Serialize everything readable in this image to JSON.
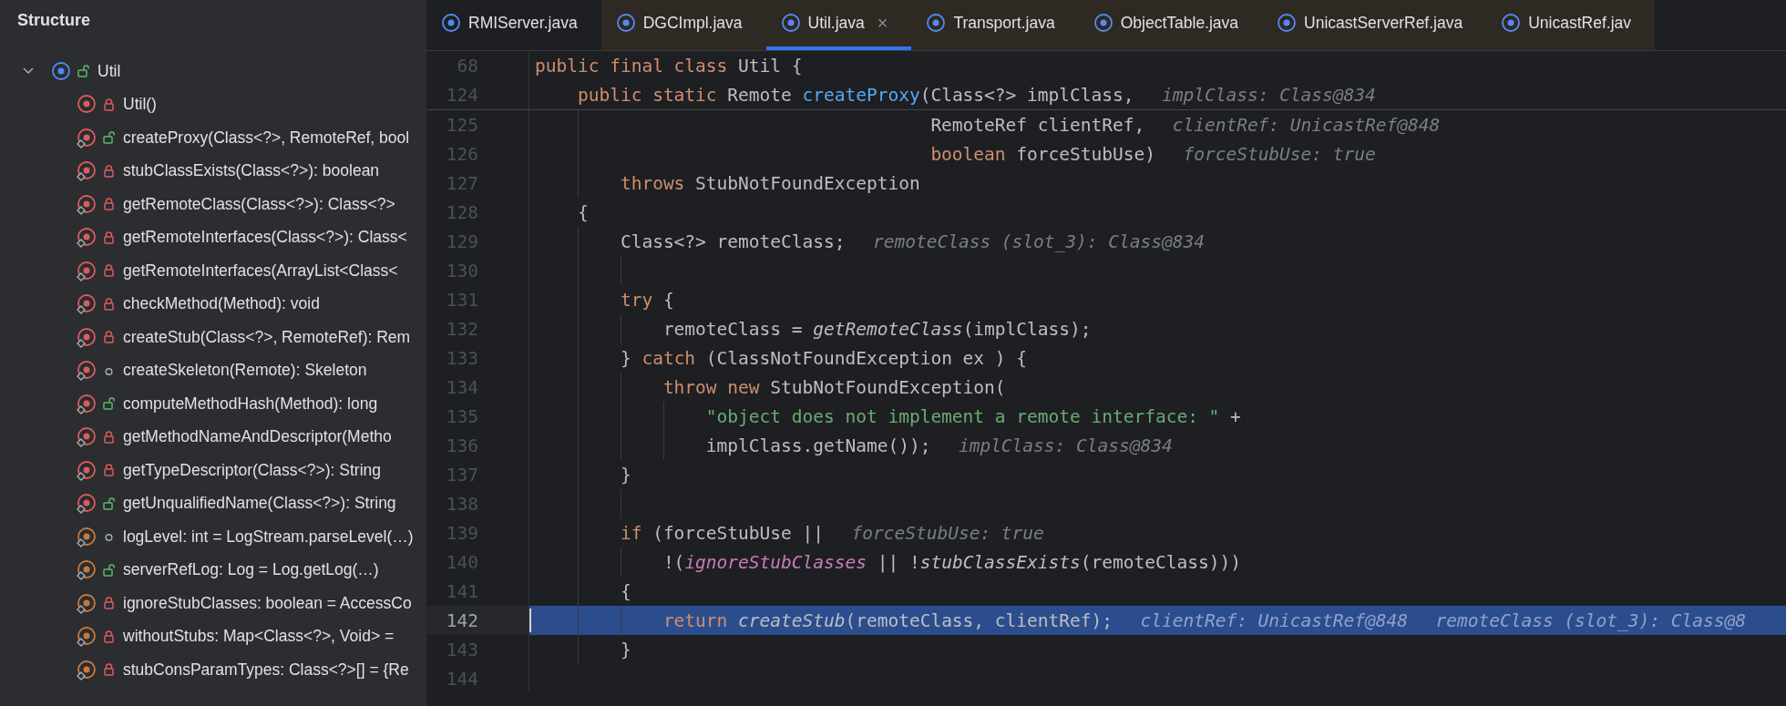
{
  "sidebar": {
    "title": "Structure",
    "tree": {
      "label": "Util",
      "kind": "class",
      "public": true,
      "private": false,
      "static": false,
      "expanded": true,
      "children": [
        {
          "label": "Util()",
          "kind": "method",
          "public": false,
          "private": true,
          "static": false
        },
        {
          "label": "createProxy(Class<?>, RemoteRef, bool",
          "kind": "method",
          "public": true,
          "private": false,
          "static": true
        },
        {
          "label": "stubClassExists(Class<?>): boolean",
          "kind": "method",
          "public": false,
          "private": true,
          "static": true
        },
        {
          "label": "getRemoteClass(Class<?>): Class<?>",
          "kind": "method",
          "public": false,
          "private": true,
          "static": true
        },
        {
          "label": "getRemoteInterfaces(Class<?>): Class<",
          "kind": "method",
          "public": false,
          "private": true,
          "static": true
        },
        {
          "label": "getRemoteInterfaces(ArrayList<Class<",
          "kind": "method",
          "public": false,
          "private": true,
          "static": true
        },
        {
          "label": "checkMethod(Method): void",
          "kind": "method",
          "public": false,
          "private": true,
          "static": true
        },
        {
          "label": "createStub(Class<?>, RemoteRef): Rem",
          "kind": "method",
          "public": false,
          "private": true,
          "static": true
        },
        {
          "label": "createSkeleton(Remote): Skeleton",
          "kind": "method",
          "public": false,
          "private": false,
          "static": true
        },
        {
          "label": "computeMethodHash(Method): long",
          "kind": "method",
          "public": true,
          "private": false,
          "static": true
        },
        {
          "label": "getMethodNameAndDescriptor(Metho",
          "kind": "method",
          "public": false,
          "private": true,
          "static": true
        },
        {
          "label": "getTypeDescriptor(Class<?>): String",
          "kind": "method",
          "public": false,
          "private": true,
          "static": true
        },
        {
          "label": "getUnqualifiedName(Class<?>): String",
          "kind": "method",
          "public": true,
          "private": false,
          "static": true
        },
        {
          "label": "logLevel: int = LogStream.parseLevel(…)",
          "kind": "field",
          "public": false,
          "private": false,
          "static": true
        },
        {
          "label": "serverRefLog: Log = Log.getLog(…)",
          "kind": "field",
          "public": true,
          "private": false,
          "static": true
        },
        {
          "label": "ignoreStubClasses: boolean = AccessCo",
          "kind": "field",
          "public": false,
          "private": true,
          "static": true
        },
        {
          "label": "withoutStubs: Map<Class<?>, Void> =",
          "kind": "field",
          "public": false,
          "private": true,
          "static": true
        },
        {
          "label": "stubConsParamTypes: Class<?>[] = {Re",
          "kind": "field",
          "public": false,
          "private": true,
          "static": true
        }
      ]
    }
  },
  "tabs": [
    {
      "label": "RMIServer.java",
      "selected": false,
      "color": "#1e1f22"
    },
    {
      "label": "DGCImpl.java",
      "selected": false,
      "color": "#2e2922"
    },
    {
      "label": "Util.java",
      "selected": true,
      "color": "#2e2922",
      "close": "×"
    },
    {
      "label": "Transport.java",
      "selected": false,
      "color": "#2e2922"
    },
    {
      "label": "ObjectTable.java",
      "selected": false,
      "color": "#2e2922"
    },
    {
      "label": "UnicastServerRef.java",
      "selected": false,
      "color": "#2e2922"
    },
    {
      "label": "UnicastRef.jav",
      "selected": false,
      "color": "#2e2922"
    }
  ],
  "sticky_lines": [
    {
      "number": "68",
      "tokens": [
        {
          "kind": "keyword",
          "text": "public final class "
        },
        {
          "kind": "plain",
          "text": "Util {"
        }
      ]
    },
    {
      "number": "124",
      "tokens": [
        {
          "kind": "keyword",
          "text": "    public static "
        },
        {
          "kind": "plain",
          "text": "Remote "
        },
        {
          "kind": "declaration",
          "text": "createProxy"
        },
        {
          "kind": "plain",
          "text": "(Class<?> implClass,"
        },
        {
          "kind": "hint",
          "text": "implClass: Class@834"
        }
      ]
    }
  ],
  "lines": [
    {
      "number": "125",
      "tokens": [
        {
          "kind": "plain",
          "text": "                                     RemoteRef clientRef,"
        },
        {
          "kind": "hint",
          "text": "clientRef: UnicastRef@848"
        }
      ]
    },
    {
      "number": "126",
      "tokens": [
        {
          "kind": "keyword",
          "text": "                                     boolean "
        },
        {
          "kind": "plain",
          "text": "forceStubUse)"
        },
        {
          "kind": "hint",
          "text": "forceStubUse: true"
        }
      ]
    },
    {
      "number": "127",
      "tokens": [
        {
          "kind": "keyword",
          "text": "        throws "
        },
        {
          "kind": "plain",
          "text": "StubNotFoundException"
        }
      ]
    },
    {
      "number": "128",
      "tokens": [
        {
          "kind": "plain",
          "text": "    {"
        }
      ]
    },
    {
      "number": "129",
      "tokens": [
        {
          "kind": "plain",
          "text": "        Class<?> remoteClass;"
        },
        {
          "kind": "hint",
          "text": "remoteClass (slot_3): Class@834"
        }
      ]
    },
    {
      "number": "130"
    },
    {
      "number": "131",
      "tokens": [
        {
          "kind": "keyword",
          "text": "        try "
        },
        {
          "kind": "plain",
          "text": "{"
        }
      ]
    },
    {
      "number": "132",
      "tokens": [
        {
          "kind": "plain",
          "text": "            remoteClass = "
        },
        {
          "kind": "call",
          "text": "getRemoteClass"
        },
        {
          "kind": "plain",
          "text": "(implClass);"
        }
      ]
    },
    {
      "number": "133",
      "tokens": [
        {
          "kind": "plain",
          "text": "        } "
        },
        {
          "kind": "keyword",
          "text": "catch "
        },
        {
          "kind": "plain",
          "text": "(ClassNotFoundException ex ) {"
        }
      ]
    },
    {
      "number": "134",
      "tokens": [
        {
          "kind": "keyword",
          "text": "            throw new "
        },
        {
          "kind": "plain",
          "text": "StubNotFoundException("
        }
      ]
    },
    {
      "number": "135",
      "tokens": [
        {
          "kind": "string",
          "text": "                \"object does not implement a remote interface: \""
        },
        {
          "kind": "plain",
          "text": " +"
        }
      ]
    },
    {
      "number": "136",
      "tokens": [
        {
          "kind": "plain",
          "text": "                implClass.getName());"
        },
        {
          "kind": "hint",
          "text": "implClass: Class@834"
        }
      ]
    },
    {
      "number": "137",
      "tokens": [
        {
          "kind": "plain",
          "text": "        }"
        }
      ]
    },
    {
      "number": "138"
    },
    {
      "number": "139",
      "tokens": [
        {
          "kind": "keyword",
          "text": "        if "
        },
        {
          "kind": "plain",
          "text": "(forceStubUse ||"
        },
        {
          "kind": "hint",
          "text": "forceStubUse: true"
        }
      ]
    },
    {
      "number": "140",
      "tokens": [
        {
          "kind": "plain",
          "text": "            !("
        },
        {
          "kind": "field",
          "text": "ignoreStubClasses"
        },
        {
          "kind": "plain",
          "text": " || !"
        },
        {
          "kind": "call",
          "text": "stubClassExists"
        },
        {
          "kind": "plain",
          "text": "(remoteClass)))"
        }
      ]
    },
    {
      "number": "141",
      "tokens": [
        {
          "kind": "plain",
          "text": "        {"
        }
      ]
    },
    {
      "number": "142",
      "selected": true,
      "tokens": [
        {
          "kind": "keyword",
          "text": "            return "
        },
        {
          "kind": "call",
          "text": "createStub"
        },
        {
          "kind": "plain",
          "text": "(remoteClass, clientRef);"
        },
        {
          "kind": "hint",
          "text": "clientRef: UnicastRef@848"
        },
        {
          "kind": "hint",
          "text": "remoteClass (slot_3): Class@8"
        }
      ]
    },
    {
      "number": "143",
      "tokens": [
        {
          "kind": "plain",
          "text": "        }"
        }
      ]
    },
    {
      "number": "144"
    }
  ]
}
